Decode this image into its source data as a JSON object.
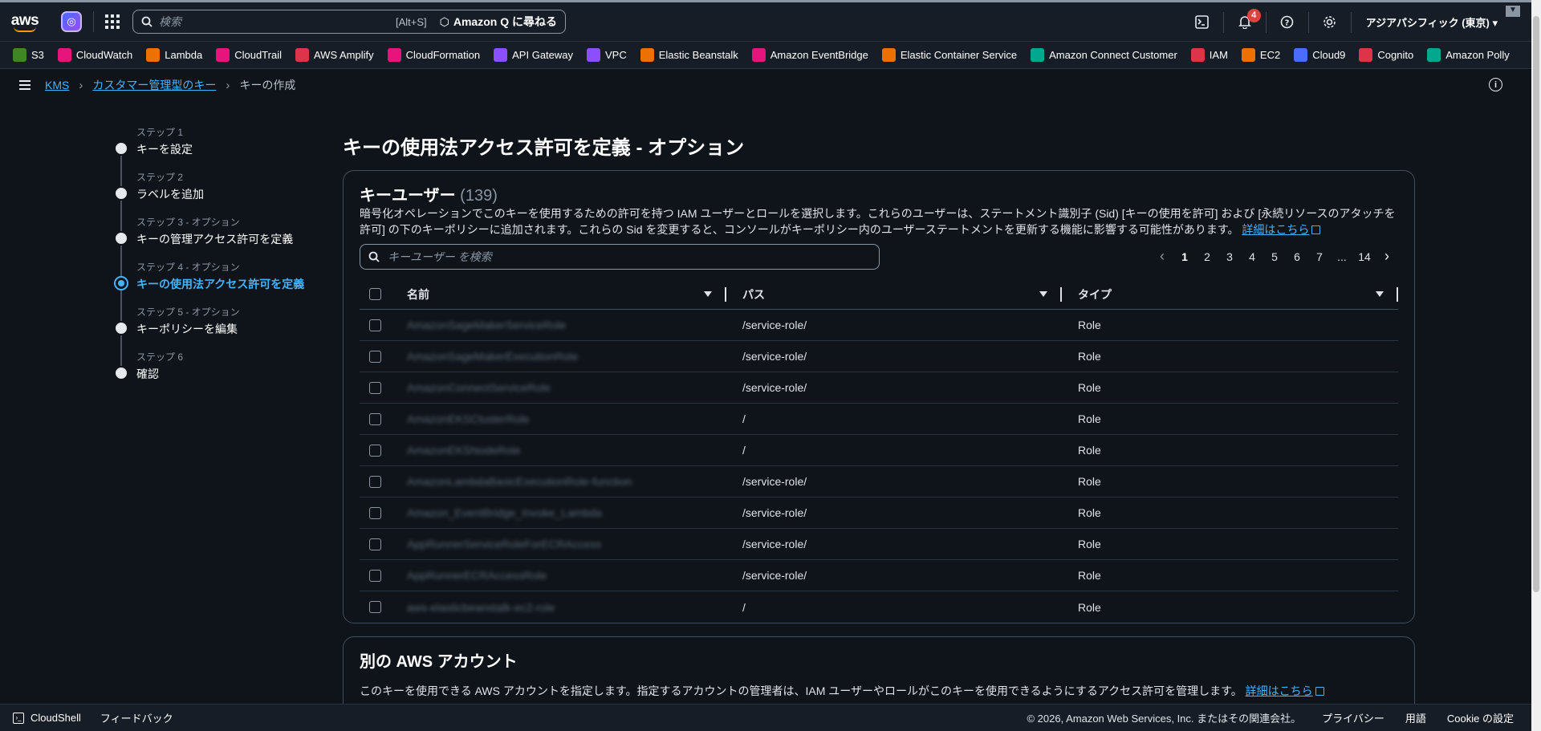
{
  "topbar": {
    "search_placeholder": "検索",
    "search_shortcut": "[Alt+S]",
    "amazon_q_label": "Amazon Q に尋ねる",
    "notification_count": "4",
    "region": "アジアパシフィック (東京) ▾"
  },
  "favorites": [
    {
      "label": "S3",
      "color": "#3f8624"
    },
    {
      "label": "CloudWatch",
      "color": "#e7157b"
    },
    {
      "label": "Lambda",
      "color": "#ed7100"
    },
    {
      "label": "CloudTrail",
      "color": "#e7157b"
    },
    {
      "label": "AWS Amplify",
      "color": "#dd344c"
    },
    {
      "label": "CloudFormation",
      "color": "#e7157b"
    },
    {
      "label": "API Gateway",
      "color": "#8c4fff"
    },
    {
      "label": "VPC",
      "color": "#8c4fff"
    },
    {
      "label": "Elastic Beanstalk",
      "color": "#ed7100"
    },
    {
      "label": "Amazon EventBridge",
      "color": "#e7157b"
    },
    {
      "label": "Elastic Container Service",
      "color": "#ed7100"
    },
    {
      "label": "Amazon Connect Customer",
      "color": "#01a88d"
    },
    {
      "label": "IAM",
      "color": "#dd344c"
    },
    {
      "label": "EC2",
      "color": "#ed7100"
    },
    {
      "label": "Cloud9",
      "color": "#4d6bff"
    },
    {
      "label": "Cognito",
      "color": "#dd344c"
    },
    {
      "label": "Amazon Polly",
      "color": "#01a88d"
    }
  ],
  "breadcrumb": {
    "root": "KMS",
    "parent": "カスタマー管理型のキー",
    "current": "キーの作成"
  },
  "steps": [
    {
      "label": "ステップ 1",
      "name": "キーを設定"
    },
    {
      "label": "ステップ 2",
      "name": "ラベルを追加"
    },
    {
      "label": "ステップ 3 - オプション",
      "name": "キーの管理アクセス許可を定義"
    },
    {
      "label": "ステップ 4 - オプション",
      "name": "キーの使用法アクセス許可を定義"
    },
    {
      "label": "ステップ 5 - オプション",
      "name": "キーポリシーを編集"
    },
    {
      "label": "ステップ 6",
      "name": "確認"
    }
  ],
  "page_title": "キーの使用法アクセス許可を定義 - オプション",
  "key_users": {
    "title": "キーユーザー",
    "count": "(139)",
    "description": "暗号化オペレーションでこのキーを使用するための許可を持つ IAM ユーザーとロールを選択します。これらのユーザーは、ステートメント識別子 (Sid) [キーの使用を許可] および [永続リソースのアタッチを許可] の下のキーポリシーに追加されます。これらの Sid を変更すると、コンソールがキーポリシー内のユーザーステートメントを更新する機能に影響する可能性があります。",
    "learn_more": "詳細はこちら",
    "filter_placeholder": "キーユーザー を検索",
    "pager": [
      "1",
      "2",
      "3",
      "4",
      "5",
      "6",
      "7",
      "...",
      "14"
    ],
    "columns": [
      "名前",
      "パス",
      "タイプ"
    ],
    "rows": [
      {
        "name": "AmazonSageMakerServiceRole",
        "path": "/service-role/",
        "type": "Role"
      },
      {
        "name": "AmazonSageMakerExecutionRole",
        "path": "/service-role/",
        "type": "Role"
      },
      {
        "name": "AmazonConnectServiceRole",
        "path": "/service-role/",
        "type": "Role"
      },
      {
        "name": "AmazonEKSClusterRole",
        "path": "/",
        "type": "Role"
      },
      {
        "name": "AmazonEKSNodeRole",
        "path": "/",
        "type": "Role"
      },
      {
        "name": "AmazonLambdaBasicExecutionRole-function",
        "path": "/service-role/",
        "type": "Role"
      },
      {
        "name": "Amazon_EventBridge_Invoke_Lambda",
        "path": "/service-role/",
        "type": "Role"
      },
      {
        "name": "AppRunnerServiceRoleForECRAccess",
        "path": "/service-role/",
        "type": "Role"
      },
      {
        "name": "AppRunnerECRAccessRole",
        "path": "/service-role/",
        "type": "Role"
      },
      {
        "name": "aws-elasticbeanstalk-ec2-role",
        "path": "/",
        "type": "Role"
      }
    ]
  },
  "other_accounts": {
    "title": "別の AWS アカウント",
    "description": "このキーを使用できる AWS アカウントを指定します。指定するアカウントの管理者は、IAM ユーザーやロールがこのキーを使用できるようにするアクセス許可を管理します。",
    "learn_more": "詳細はこちら"
  },
  "footer": {
    "cloudshell": "CloudShell",
    "feedback": "フィードバック",
    "copyright": "© 2026, Amazon Web Services, Inc. またはその関連会社。",
    "privacy": "プライバシー",
    "terms": "用語",
    "cookie": "Cookie の設定"
  }
}
